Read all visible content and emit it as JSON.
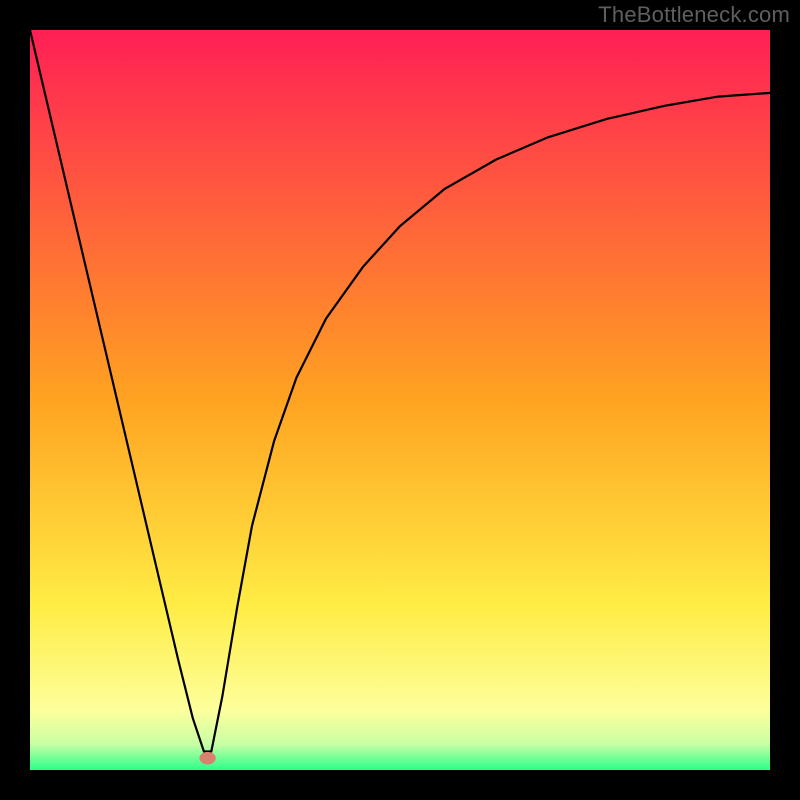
{
  "watermark": "TheBottleneck.com",
  "chart_data": {
    "type": "line",
    "title": "",
    "xlabel": "",
    "ylabel": "",
    "xlim": [
      0,
      100
    ],
    "ylim": [
      0,
      100
    ],
    "grid": false,
    "background_gradient": {
      "stops": [
        {
          "offset": 0.0,
          "color": "#ff1f55"
        },
        {
          "offset": 0.5,
          "color": "#ffa321"
        },
        {
          "offset": 0.78,
          "color": "#ffed45"
        },
        {
          "offset": 0.92,
          "color": "#fdff9d"
        },
        {
          "offset": 0.965,
          "color": "#c8ffa4"
        },
        {
          "offset": 1.0,
          "color": "#2aff8a"
        }
      ]
    },
    "series": [
      {
        "name": "curve",
        "type": "line",
        "color": "#000000",
        "x": [
          0.0,
          2.0,
          4.0,
          6.0,
          8.0,
          10.0,
          12.0,
          14.0,
          16.0,
          18.0,
          20.0,
          22.0,
          23.5,
          24.5,
          26.0,
          28.0,
          30.0,
          33.0,
          36.0,
          40.0,
          45.0,
          50.0,
          56.0,
          63.0,
          70.0,
          78.0,
          86.0,
          93.0,
          100.0
        ],
        "values": [
          100.0,
          91.5,
          83.0,
          74.5,
          66.0,
          57.5,
          49.0,
          40.5,
          32.0,
          23.5,
          15.0,
          7.0,
          2.5,
          2.5,
          10.0,
          22.0,
          33.0,
          44.5,
          53.0,
          61.0,
          68.0,
          73.5,
          78.5,
          82.5,
          85.5,
          88.0,
          89.8,
          91.0,
          91.5
        ]
      }
    ],
    "marker": {
      "name": "min-marker",
      "x": 24.0,
      "y": 1.6,
      "rx": 1.1,
      "ry": 0.85,
      "color": "#d9806e"
    }
  }
}
